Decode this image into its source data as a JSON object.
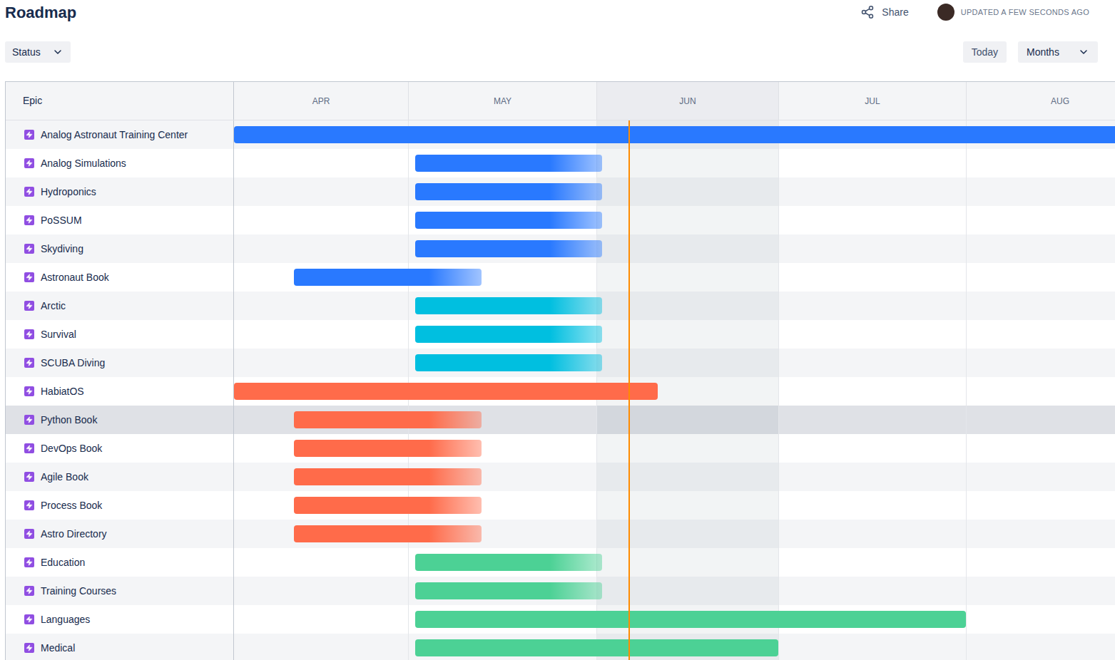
{
  "page": {
    "title": "Roadmap"
  },
  "share": {
    "label": "Share"
  },
  "updated": {
    "label": "UPDATED A FEW SECONDS AGO"
  },
  "filters": [
    {
      "label": "Status"
    }
  ],
  "today_button": {
    "label": "Today"
  },
  "zoom": {
    "label": "Months"
  },
  "table": {
    "column": "Epic",
    "months": [
      {
        "label": "APR",
        "current": false
      },
      {
        "label": "MAY",
        "current": false
      },
      {
        "label": "JUN",
        "current": true
      },
      {
        "label": "JUL",
        "current": false
      },
      {
        "label": "AUG",
        "current": false
      }
    ],
    "today": 2.18,
    "epics": [
      {
        "name": "Analog Astronaut Training Center",
        "selected": false,
        "color": "#2979ff",
        "start": 0,
        "end": 5,
        "fade": false
      },
      {
        "name": "Analog Simulations",
        "selected": false,
        "color": "#2979ff",
        "start": 1.038,
        "end": 2.031,
        "fade": true
      },
      {
        "name": "Hydroponics",
        "selected": false,
        "color": "#2979ff",
        "start": 1.038,
        "end": 2.031,
        "fade": true
      },
      {
        "name": "PoSSUM",
        "selected": false,
        "color": "#2979ff",
        "start": 1.038,
        "end": 2.031,
        "fade": true
      },
      {
        "name": "Skydiving",
        "selected": false,
        "color": "#2979ff",
        "start": 1.038,
        "end": 2.031,
        "fade": true
      },
      {
        "name": "Astronaut Book",
        "selected": false,
        "color": "#2979ff",
        "start": 0.344,
        "end": 1.39,
        "fade": true
      },
      {
        "name": "Arctic",
        "selected": false,
        "color": "#00bfe0",
        "start": 1.038,
        "end": 2.031,
        "fade": true
      },
      {
        "name": "Survival",
        "selected": false,
        "color": "#00bfe0",
        "start": 1.038,
        "end": 2.031,
        "fade": true
      },
      {
        "name": "SCUBA Diving",
        "selected": false,
        "color": "#00bfe0",
        "start": 1.038,
        "end": 2.031,
        "fade": true
      },
      {
        "name": "HabiatOS",
        "selected": false,
        "color": "#ff6b4a",
        "start": 0,
        "end": 2.337,
        "fade": false
      },
      {
        "name": "Python Book",
        "selected": true,
        "color": "#ff6b4a",
        "start": 0.344,
        "end": 1.39,
        "fade": true
      },
      {
        "name": "DevOps Book",
        "selected": false,
        "color": "#ff6b4a",
        "start": 0.344,
        "end": 1.39,
        "fade": true
      },
      {
        "name": "Agile Book",
        "selected": false,
        "color": "#ff6b4a",
        "start": 0.344,
        "end": 1.39,
        "fade": true
      },
      {
        "name": "Process Book",
        "selected": false,
        "color": "#ff6b4a",
        "start": 0.344,
        "end": 1.39,
        "fade": true
      },
      {
        "name": "Astro Directory",
        "selected": false,
        "color": "#ff6b4a",
        "start": 0.344,
        "end": 1.39,
        "fade": true
      },
      {
        "name": "Education",
        "selected": false,
        "color": "#4cd195",
        "start": 1.038,
        "end": 2.031,
        "fade": true
      },
      {
        "name": "Training Courses",
        "selected": false,
        "color": "#4cd195",
        "start": 1.038,
        "end": 2.031,
        "fade": true
      },
      {
        "name": "Languages",
        "selected": false,
        "color": "#4cd195",
        "start": 1.038,
        "end": 4.0,
        "fade": false
      },
      {
        "name": "Medical",
        "selected": false,
        "color": "#4cd195",
        "start": 1.038,
        "end": 3.0,
        "fade": false
      }
    ]
  }
}
